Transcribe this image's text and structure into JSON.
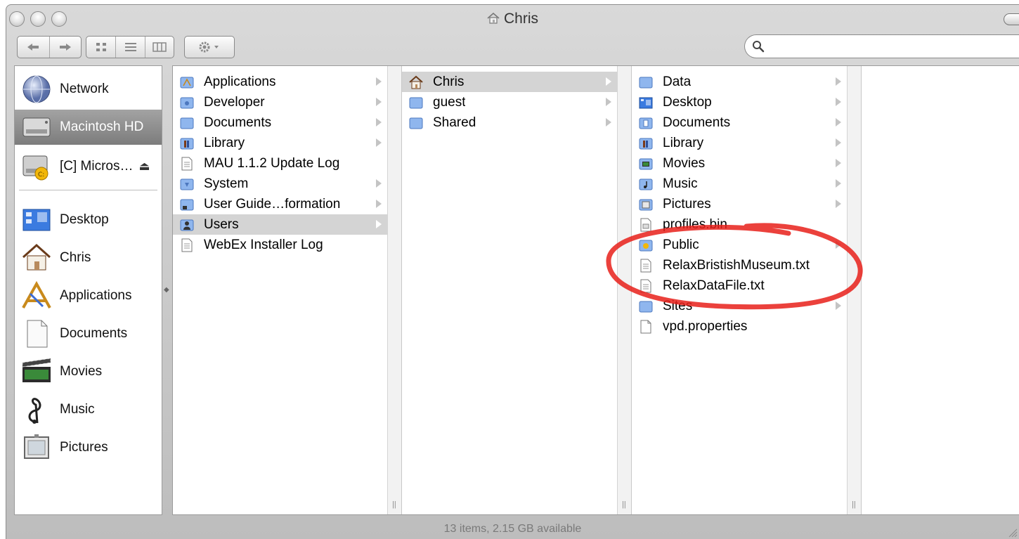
{
  "window": {
    "title": "Chris"
  },
  "toolbar": {
    "back_icon": "back-arrow-icon",
    "forward_icon": "forward-arrow-icon",
    "view_icons": [
      "icon-view-icon",
      "list-view-icon",
      "column-view-icon"
    ],
    "action_icon": "gear-icon",
    "search_placeholder": ""
  },
  "sidebar": {
    "devices": [
      {
        "label": "Network",
        "icon": "globe-icon"
      },
      {
        "label": "Macintosh HD",
        "icon": "hard-drive-icon",
        "selected": true
      },
      {
        "label": "[C] Micros…",
        "icon": "windows-drive-icon",
        "eject": "⏏"
      }
    ],
    "places": [
      {
        "label": "Desktop",
        "icon": "desktop-icon"
      },
      {
        "label": "Chris",
        "icon": "home-icon"
      },
      {
        "label": "Applications",
        "icon": "applications-icon"
      },
      {
        "label": "Documents",
        "icon": "documents-icon"
      },
      {
        "label": "Movies",
        "icon": "movies-icon"
      },
      {
        "label": "Music",
        "icon": "music-icon"
      },
      {
        "label": "Pictures",
        "icon": "pictures-icon"
      }
    ]
  },
  "columns": [
    {
      "items": [
        {
          "label": "Applications",
          "type": "applications-folder",
          "arrow": true
        },
        {
          "label": "Developer",
          "type": "folder",
          "arrow": true
        },
        {
          "label": "Documents",
          "type": "folder",
          "arrow": true
        },
        {
          "label": "Library",
          "type": "library-folder",
          "arrow": true
        },
        {
          "label": "MAU 1.1.2 Update Log",
          "type": "text-file",
          "arrow": false
        },
        {
          "label": "System",
          "type": "folder",
          "arrow": true
        },
        {
          "label": "User Guide…formation",
          "type": "folder",
          "arrow": true
        },
        {
          "label": "Users",
          "type": "users-folder",
          "arrow": true,
          "selected": true
        },
        {
          "label": "WebEx Installer Log",
          "type": "text-file",
          "arrow": false
        }
      ]
    },
    {
      "items": [
        {
          "label": "Chris",
          "type": "home",
          "arrow": true,
          "selected": true
        },
        {
          "label": "guest",
          "type": "folder",
          "arrow": true
        },
        {
          "label": "Shared",
          "type": "folder",
          "arrow": true
        }
      ]
    },
    {
      "items": [
        {
          "label": "Data",
          "type": "folder",
          "arrow": true
        },
        {
          "label": "Desktop",
          "type": "desktop-folder",
          "arrow": true
        },
        {
          "label": "Documents",
          "type": "folder",
          "arrow": true
        },
        {
          "label": "Library",
          "type": "library-folder",
          "arrow": true
        },
        {
          "label": "Movies",
          "type": "movies-folder",
          "arrow": true
        },
        {
          "label": "Music",
          "type": "music-folder",
          "arrow": true
        },
        {
          "label": "Pictures",
          "type": "pictures-folder",
          "arrow": true
        },
        {
          "label": "profiles.bin",
          "type": "binary-file",
          "arrow": false
        },
        {
          "label": "Public",
          "type": "public-folder",
          "arrow": true
        },
        {
          "label": "RelaxBristishMuseum.txt",
          "type": "text-file",
          "arrow": false
        },
        {
          "label": "RelaxDataFile.txt",
          "type": "text-file",
          "arrow": false
        },
        {
          "label": "Sites",
          "type": "folder",
          "arrow": true
        },
        {
          "label": "vpd.properties",
          "type": "blank-file",
          "arrow": false
        }
      ]
    },
    {
      "items": []
    }
  ],
  "status_bar": {
    "text": "13 items, 2.15 GB available"
  },
  "annotation": {
    "color": "#e8201a",
    "shape": "hand-drawn ellipse around RelaxBristishMuseum.txt and RelaxDataFile.txt"
  }
}
